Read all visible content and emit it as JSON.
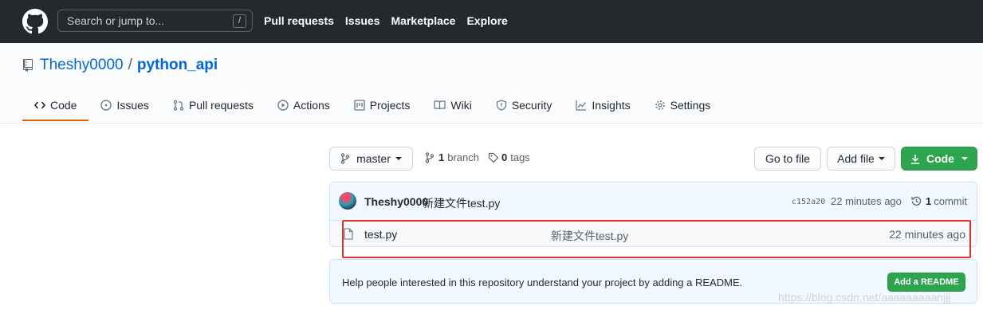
{
  "header": {
    "search_placeholder": "Search or jump to...",
    "search_shortcut": "/",
    "nav": [
      "Pull requests",
      "Issues",
      "Marketplace",
      "Explore"
    ]
  },
  "repo": {
    "owner": "Theshy0000",
    "separator": "/",
    "name": "python_api"
  },
  "tabs": [
    {
      "label": "Code",
      "icon": "code-icon",
      "active": true
    },
    {
      "label": "Issues",
      "icon": "issue-icon"
    },
    {
      "label": "Pull requests",
      "icon": "pull-request-icon"
    },
    {
      "label": "Actions",
      "icon": "play-icon"
    },
    {
      "label": "Projects",
      "icon": "project-icon"
    },
    {
      "label": "Wiki",
      "icon": "book-icon"
    },
    {
      "label": "Security",
      "icon": "shield-icon"
    },
    {
      "label": "Insights",
      "icon": "graph-icon"
    },
    {
      "label": "Settings",
      "icon": "gear-icon"
    }
  ],
  "controls": {
    "branch_button": "master",
    "branch_count": "1",
    "branch_word": "branch",
    "tag_count": "0",
    "tag_word": "tags",
    "go_to_file": "Go to file",
    "add_file": "Add file",
    "code": "Code"
  },
  "commit": {
    "author": "Theshy0000",
    "message": "新建文件test.py",
    "sha": "c152a20",
    "time": "22 minutes ago",
    "count": "1",
    "count_word": "commit"
  },
  "files": [
    {
      "name": "test.py",
      "message": "新建文件test.py",
      "time": "22 minutes ago"
    }
  ],
  "readme": {
    "text": "Help people interested in this repository understand your project by adding a README.",
    "button": "Add a README"
  },
  "watermark": "https://blog.csdn.net/aaaaaaaaanjjj",
  "colors": {
    "header_bg": "#24292e",
    "link": "#0366d6",
    "green": "#2ea44f",
    "highlight": "#e03131",
    "tab_underline": "#e36209"
  }
}
